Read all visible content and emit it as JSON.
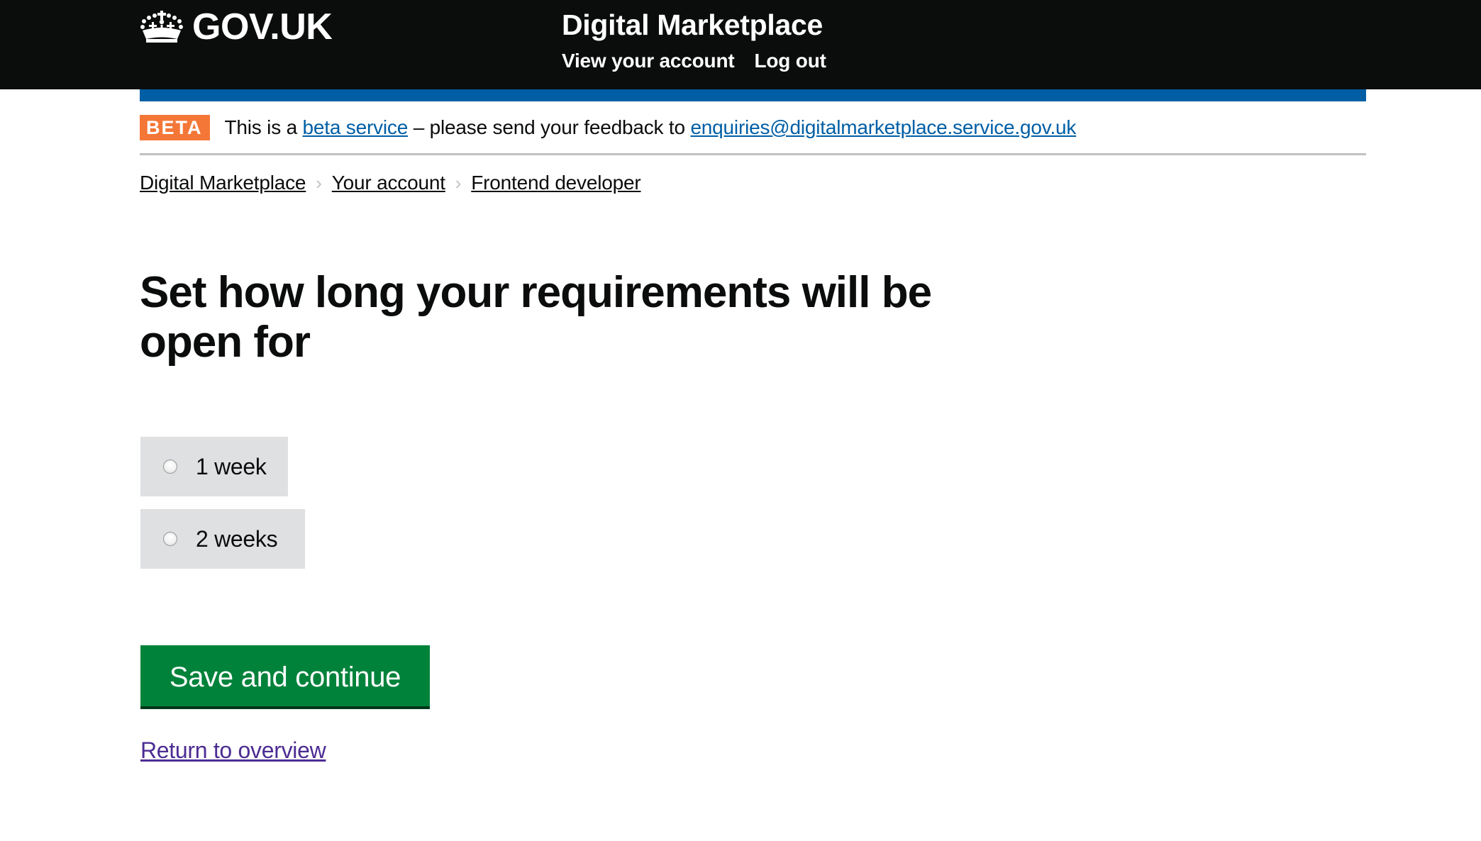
{
  "header": {
    "logo_text": "GOV.UK",
    "logo_icon": "crown-icon",
    "service_name": "Digital Marketplace",
    "nav": [
      {
        "label": "View your account"
      },
      {
        "label": "Log out"
      }
    ]
  },
  "colors": {
    "header_bg": "#0b0c0c",
    "blue_bar": "#005ea5",
    "beta_tag": "#f47738",
    "link": "#005ea5",
    "visited_link": "#4c2c92",
    "button_green": "#00823b",
    "radio_bg": "#dee0e2"
  },
  "phase_banner": {
    "tag": "BETA",
    "text_before": "This is a ",
    "link1": "beta service",
    "text_middle": " – please send your feedback to ",
    "link2": "enquiries@digitalmarketplace.service.gov.uk"
  },
  "breadcrumbs": [
    {
      "label": "Digital Marketplace"
    },
    {
      "label": "Your account"
    },
    {
      "label": "Frontend developer"
    }
  ],
  "breadcrumb_separator": "›",
  "main": {
    "title": "Set how long your requirements will be open for",
    "options": [
      {
        "label": "1 week",
        "checked": false
      },
      {
        "label": "2 weeks",
        "checked": false
      }
    ],
    "submit_label": "Save and continue",
    "return_link": "Return to overview"
  }
}
